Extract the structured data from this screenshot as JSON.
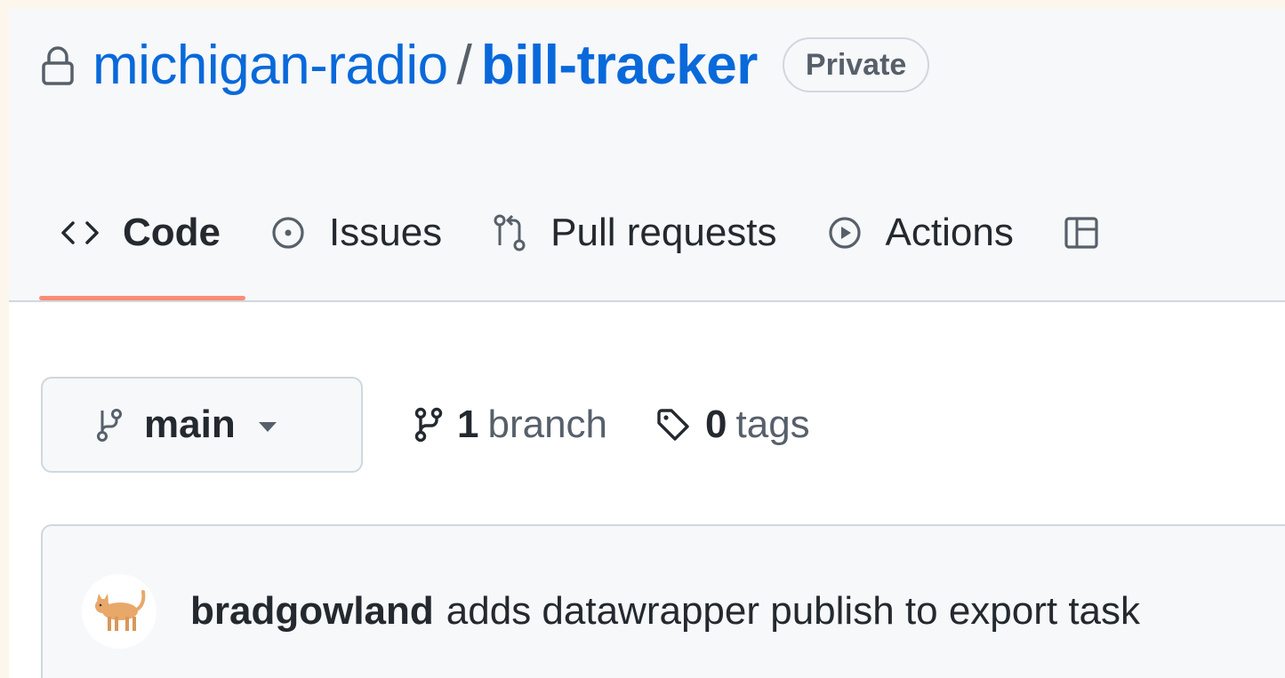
{
  "repo": {
    "owner": "michigan-radio",
    "separator": "/",
    "name": "bill-tracker",
    "visibility": "Private",
    "icon": "lock-icon"
  },
  "tabs": [
    {
      "label": "Code",
      "icon": "code-icon",
      "active": true
    },
    {
      "label": "Issues",
      "icon": "issue-opened-icon",
      "active": false
    },
    {
      "label": "Pull requests",
      "icon": "git-pull-request-icon",
      "active": false
    },
    {
      "label": "Actions",
      "icon": "play-icon",
      "active": false
    }
  ],
  "branch_selector": {
    "label": "main",
    "icon": "git-branch-icon"
  },
  "branches": {
    "count": "1",
    "word": "branch",
    "icon": "git-branch-icon"
  },
  "tags": {
    "count": "0",
    "word": "tags",
    "icon": "tag-icon"
  },
  "latest_commit": {
    "author": "bradgowland",
    "message": "adds datawrapper publish to export task",
    "avatar_icon": "cat-avatar"
  },
  "colors": {
    "link": "#0969da",
    "active_tab_underline": "#fd8c73",
    "muted_text": "#57606a",
    "border": "#d0d7de",
    "background_outer": "#fdf6ec"
  }
}
